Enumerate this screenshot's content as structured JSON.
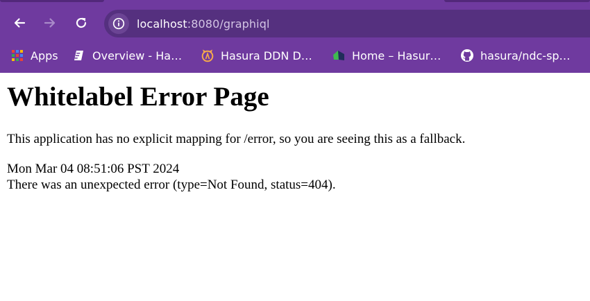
{
  "browser": {
    "url_host": "localhost",
    "url_rest": ":8080/graphiql",
    "bookmarks": [
      {
        "label": "Apps",
        "icon": "apps-grid-icon"
      },
      {
        "label": "Overview - Ha…",
        "icon": "document-icon"
      },
      {
        "label": "Hasura DDN D…",
        "icon": "hasura-logo-icon"
      },
      {
        "label": "Home – Hasur…",
        "icon": "home-favicon-icon"
      },
      {
        "label": "hasura/ndc-sp…",
        "icon": "github-icon"
      }
    ],
    "colors": {
      "chrome": "#6f3a9f",
      "address_bar": "#55307f"
    }
  },
  "page": {
    "title": "Whitelabel Error Page",
    "message": "This application has no explicit mapping for /error, so you are seeing this as a fallback.",
    "timestamp": "Mon Mar 04 08:51:06 PST 2024",
    "error_detail": "There was an unexpected error (type=Not Found, status=404)."
  }
}
